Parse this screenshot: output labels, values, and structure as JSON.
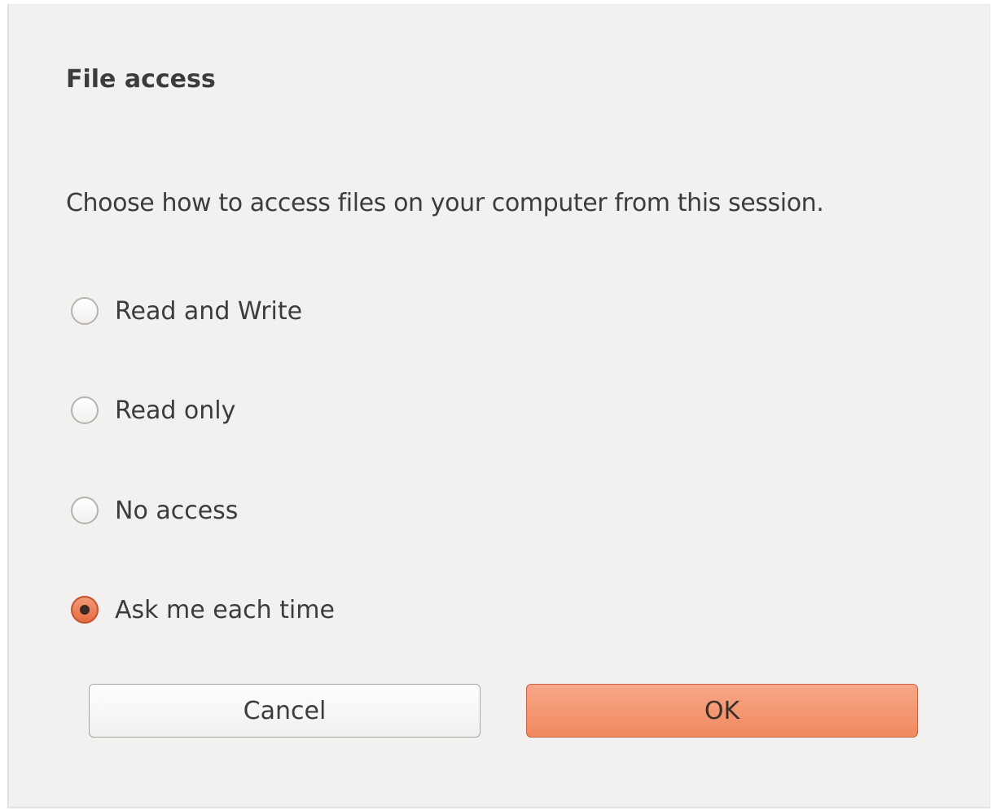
{
  "dialog": {
    "title": "File access",
    "description": "Choose how to access files on your computer from this session.",
    "options": [
      {
        "label": "Read and Write",
        "checked": false
      },
      {
        "label": "Read only",
        "checked": false
      },
      {
        "label": "No access",
        "checked": false
      },
      {
        "label": "Ask me each time",
        "checked": true
      }
    ],
    "buttons": {
      "cancel_label": "Cancel",
      "ok_label": "OK"
    }
  },
  "colors": {
    "dialog_background": "#f2f1f0",
    "accent": "#f0895f",
    "text": "#3c3c3c"
  }
}
